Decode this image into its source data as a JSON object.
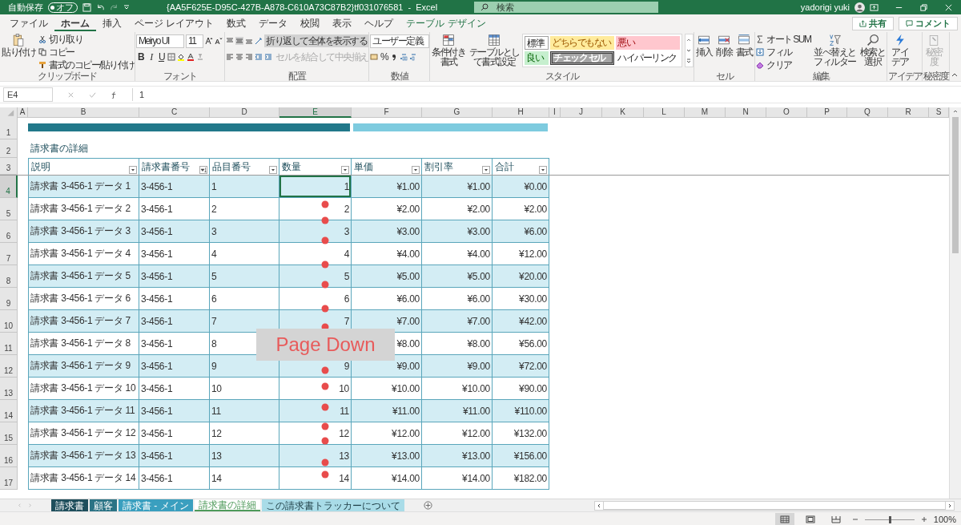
{
  "title_bar": {
    "autosave_label": "自動保存",
    "autosave_state": "オフ",
    "autosave_on": false,
    "title": "{AA5F625E-D95C-427B-A878-C610A73C87B2}tf031076581  -  Excel",
    "search_placeholder": "検索",
    "user": "yadorigi yuki"
  },
  "menu_tabs": [
    {
      "label": "ファイル",
      "kind": "normal",
      "selected": false
    },
    {
      "label": "ホーム",
      "kind": "normal",
      "selected": true
    },
    {
      "label": "挿入",
      "kind": "normal",
      "selected": false
    },
    {
      "label": "ページ レイアウト",
      "kind": "normal",
      "selected": false
    },
    {
      "label": "数式",
      "kind": "normal",
      "selected": false
    },
    {
      "label": "データ",
      "kind": "normal",
      "selected": false
    },
    {
      "label": "校閲",
      "kind": "normal",
      "selected": false
    },
    {
      "label": "表示",
      "kind": "normal",
      "selected": false
    },
    {
      "label": "ヘルプ",
      "kind": "normal",
      "selected": false
    },
    {
      "label": "テーブル デザイン",
      "kind": "contextual",
      "selected": false
    }
  ],
  "share": "共有",
  "comments": "コメント",
  "ribbon": {
    "clipboard": {
      "label": "クリップボード",
      "paste": "貼り付け",
      "cut": "切り取り",
      "copy": "コピー",
      "format_painter": "書式のコピー/貼り付け"
    },
    "font": {
      "label": "フォント",
      "name": "Meiryo UI",
      "size": "11",
      "bold": "B",
      "italic": "I",
      "underline": "U"
    },
    "alignment": {
      "label": "配置",
      "wrap_text": {
        "label": "折り返して全体を表示する",
        "selected": true
      },
      "merge": {
        "label": "セルを結合して中央揃え",
        "disabled": true
      }
    },
    "number": {
      "label": "数値",
      "format": "ユーザー定義",
      "percent": "%"
    },
    "styles": {
      "label": "スタイル",
      "conditional": "条件付き書式",
      "table_format": "テーブルとして書式設定",
      "cell_styles": [
        {
          "label": "標準",
          "kind": "normal"
        },
        {
          "label": "どちらでもない",
          "kind": "neutral"
        },
        {
          "label": "悪い",
          "kind": "bad"
        },
        {
          "label": "良い",
          "kind": "good"
        },
        {
          "label": "チェック セル",
          "kind": "check"
        },
        {
          "label": "ハイパーリンク",
          "kind": "hyperlink"
        }
      ]
    },
    "cells": {
      "label": "セル",
      "buttons": [
        {
          "label": "挿入",
          "kind": "insert"
        },
        {
          "label": "削除",
          "kind": "delete"
        },
        {
          "label": "書式",
          "kind": "format"
        }
      ]
    },
    "editing": {
      "label": "編集",
      "autosum": "オート SUM",
      "fill": "フィル",
      "clear": "クリア",
      "sort": "並べ替えとフィルター",
      "find": "検索と選択"
    },
    "ideas": {
      "label": "アイデア",
      "button": "アイデア"
    },
    "sensitivity": {
      "label": "秘密度",
      "button": "秘密度",
      "disabled": true
    }
  },
  "formula_bar": {
    "name_box": "E4",
    "value": "1"
  },
  "sheet": {
    "columns": [
      {
        "letter": "A",
        "selected": false
      },
      {
        "letter": "B",
        "selected": false
      },
      {
        "letter": "C",
        "selected": false
      },
      {
        "letter": "D",
        "selected": false
      },
      {
        "letter": "E",
        "selected": true
      },
      {
        "letter": "F",
        "selected": false
      },
      {
        "letter": "G",
        "selected": false
      },
      {
        "letter": "H",
        "selected": false
      },
      {
        "letter": "I",
        "selected": false
      },
      {
        "letter": "J",
        "selected": false
      },
      {
        "letter": "K",
        "selected": false
      },
      {
        "letter": "L",
        "selected": false
      },
      {
        "letter": "M",
        "selected": false
      },
      {
        "letter": "N",
        "selected": false
      },
      {
        "letter": "O",
        "selected": false
      },
      {
        "letter": "P",
        "selected": false
      },
      {
        "letter": "Q",
        "selected": false
      },
      {
        "letter": "R",
        "selected": false
      },
      {
        "letter": "S",
        "selected": false
      }
    ],
    "row_headers": [
      {
        "label": "1",
        "selected": false
      },
      {
        "label": "2",
        "selected": false
      },
      {
        "label": "3",
        "selected": false
      },
      {
        "label": "4",
        "selected": true
      },
      {
        "label": "5",
        "selected": false
      },
      {
        "label": "6",
        "selected": false
      },
      {
        "label": "7",
        "selected": false
      },
      {
        "label": "8",
        "selected": false
      },
      {
        "label": "9",
        "selected": false
      },
      {
        "label": "10",
        "selected": false
      },
      {
        "label": "11",
        "selected": false
      },
      {
        "label": "12",
        "selected": false
      },
      {
        "label": "13",
        "selected": false
      },
      {
        "label": "14",
        "selected": false
      },
      {
        "label": "15",
        "selected": false
      },
      {
        "label": "16",
        "selected": false
      },
      {
        "label": "17",
        "selected": false
      }
    ],
    "title": "請求書の詳細"
  },
  "table": {
    "headers": [
      {
        "label": "説明",
        "sorted": false
      },
      {
        "label": "請求書番号",
        "sorted": true
      },
      {
        "label": "品目番号",
        "sorted": false
      },
      {
        "label": "数量",
        "sorted": false
      },
      {
        "label": "単価",
        "sorted": false
      },
      {
        "label": "割引率",
        "sorted": false
      },
      {
        "label": "合計",
        "sorted": false
      }
    ],
    "rows": [
      [
        "請求書 3-456-1 データ 1",
        "3-456-1",
        "1",
        "1",
        "¥1.00",
        "¥1.00",
        "¥0.00"
      ],
      [
        "請求書 3-456-1 データ 2",
        "3-456-1",
        "2",
        "2",
        "¥2.00",
        "¥2.00",
        "¥2.00"
      ],
      [
        "請求書 3-456-1 データ 3",
        "3-456-1",
        "3",
        "3",
        "¥3.00",
        "¥3.00",
        "¥6.00"
      ],
      [
        "請求書 3-456-1 データ 4",
        "3-456-1",
        "4",
        "4",
        "¥4.00",
        "¥4.00",
        "¥12.00"
      ],
      [
        "請求書 3-456-1 データ 5",
        "3-456-1",
        "5",
        "5",
        "¥5.00",
        "¥5.00",
        "¥20.00"
      ],
      [
        "請求書 3-456-1 データ 6",
        "3-456-1",
        "6",
        "6",
        "¥6.00",
        "¥6.00",
        "¥30.00"
      ],
      [
        "請求書 3-456-1 データ 7",
        "3-456-1",
        "7",
        "7",
        "¥7.00",
        "¥7.00",
        "¥42.00"
      ],
      [
        "請求書 3-456-1 データ 8",
        "3-456-1",
        "8",
        null,
        "¥8.00",
        "¥8.00",
        "¥56.00"
      ],
      [
        "請求書 3-456-1 データ 9",
        "3-456-1",
        "9",
        "9",
        "¥9.00",
        "¥9.00",
        "¥72.00"
      ],
      [
        "請求書 3-456-1 データ 10",
        "3-456-1",
        "10",
        "10",
        "¥10.00",
        "¥10.00",
        "¥90.00"
      ],
      [
        "請求書 3-456-1 データ 11",
        "3-456-1",
        "11",
        "11",
        "¥11.00",
        "¥11.00",
        "¥110.00"
      ],
      [
        "請求書 3-456-1 データ 12",
        "3-456-1",
        "12",
        "12",
        "¥12.00",
        "¥12.00",
        "¥132.00"
      ],
      [
        "請求書 3-456-1 データ 13",
        "3-456-1",
        "13",
        "13",
        "¥13.00",
        "¥13.00",
        "¥156.00"
      ],
      [
        "請求書 3-456-1 データ 14",
        "3-456-1",
        "14",
        "14",
        "¥14.00",
        "¥14.00",
        "¥182.00"
      ]
    ]
  },
  "overlay": {
    "text": "Page Down"
  },
  "sheet_tabs": [
    {
      "label": "請求書",
      "color": "#1e4e5c",
      "selected": false
    },
    {
      "label": "顧客",
      "color": "#2b7385",
      "selected": false
    },
    {
      "label": "請求書 - メイン",
      "color": "#3a9fbf",
      "selected": false
    },
    {
      "label": "請求書の詳細",
      "color": "#4e9a5a",
      "selected": true
    },
    {
      "label": "この請求書トラッカーについて",
      "color": "#a9dce8",
      "selected": false
    }
  ],
  "status_bar": {
    "views": [
      {
        "kind": "normal",
        "selected": true
      },
      {
        "kind": "page_layout",
        "selected": false
      },
      {
        "kind": "page_break",
        "selected": false
      }
    ],
    "zoom": {
      "level": 0.5,
      "reading": "100%"
    }
  }
}
